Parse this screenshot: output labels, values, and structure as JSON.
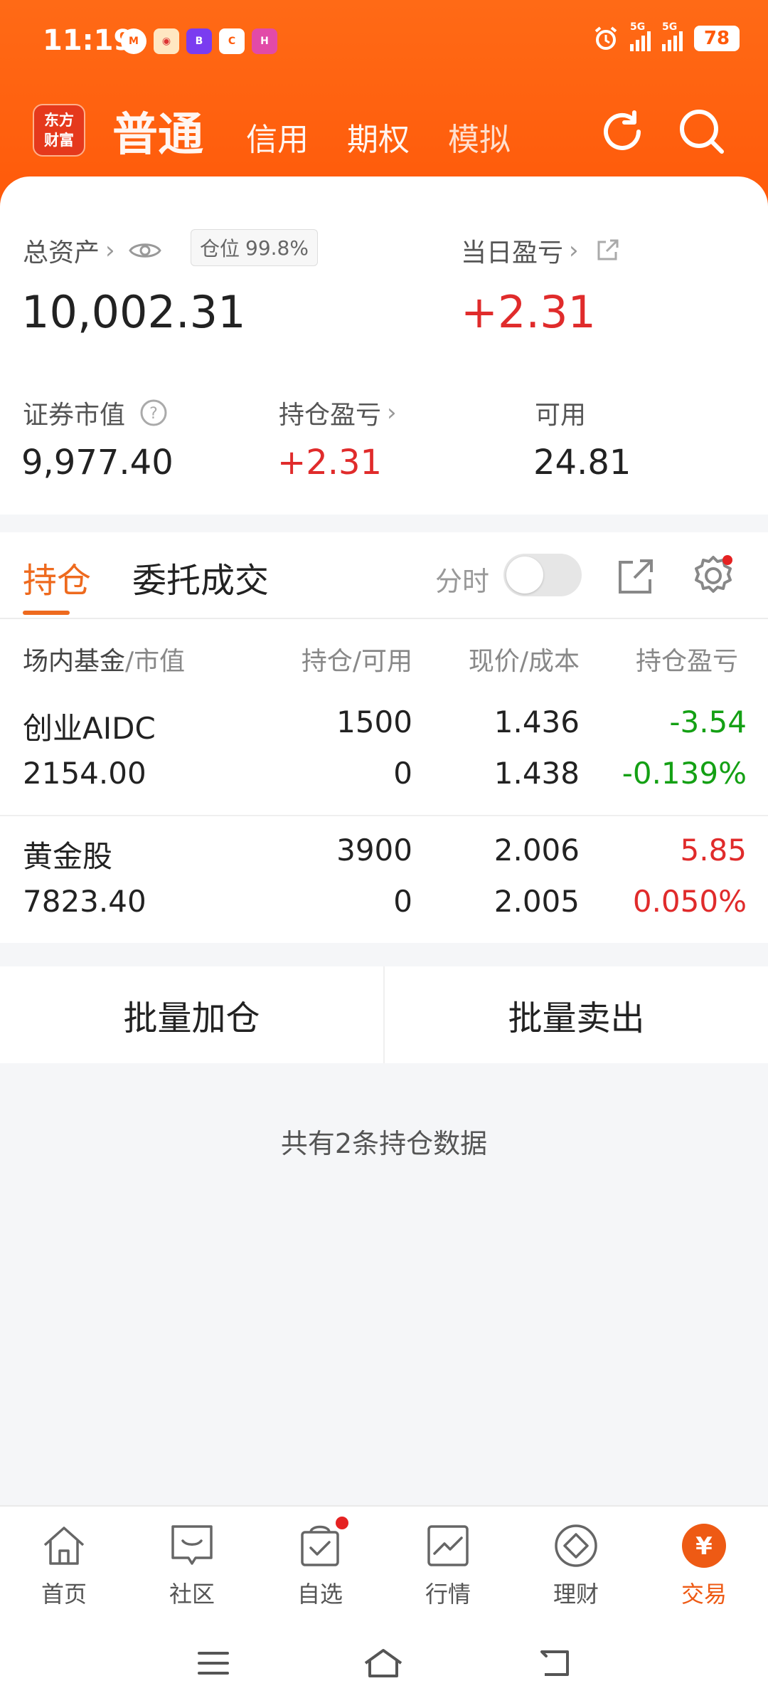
{
  "status": {
    "time": "11:19",
    "net1": "5G",
    "net2": "5G",
    "battery": "78"
  },
  "header": {
    "logo": [
      "东方",
      "财富"
    ],
    "tabs": [
      {
        "label": "普通",
        "active": true
      },
      {
        "label": "信用",
        "active": false
      },
      {
        "label": "期权",
        "active": false
      },
      {
        "label": "模拟",
        "active": false
      }
    ],
    "icons": [
      "refresh-icon",
      "search-icon"
    ]
  },
  "summary": {
    "total_assets_label": "总资产",
    "position_label": "仓位",
    "position_value": "99.8%",
    "total_assets_value": "10,002.31",
    "daily_pl_label": "当日盈亏",
    "daily_pl_value": "+2.31",
    "market_value_label": "证券市值",
    "market_value_value": "9,977.40",
    "holding_pl_label": "持仓盈亏",
    "holding_pl_value": "+2.31",
    "available_label": "可用",
    "available_value": "24.81"
  },
  "position_tabs": {
    "holdings": "持仓",
    "orders": "委托成交",
    "timeshare": "分时"
  },
  "table": {
    "headers": {
      "col1_main": "场内基金",
      "col1_sub": "/市值",
      "col2": "持仓/可用",
      "col3": "现价/成本",
      "col4": "持仓盈亏"
    },
    "rows": [
      {
        "name": "创业AIDC",
        "market_value": "2154.00",
        "holding": "1500",
        "available": "0",
        "price": "1.436",
        "cost": "1.438",
        "pl": "-3.54",
        "pl_pct": "-0.139%",
        "dir": "down"
      },
      {
        "name": "黄金股",
        "market_value": "7823.40",
        "holding": "3900",
        "available": "0",
        "price": "2.006",
        "cost": "2.005",
        "pl": "5.85",
        "pl_pct": "0.050%",
        "dir": "up"
      }
    ]
  },
  "batch": {
    "add": "批量加仓",
    "sell": "批量卖出"
  },
  "count_text": "共有2条持仓数据",
  "nav": [
    {
      "label": "首页",
      "icon": "home-icon"
    },
    {
      "label": "社区",
      "icon": "community-icon"
    },
    {
      "label": "自选",
      "icon": "watchlist-icon"
    },
    {
      "label": "行情",
      "icon": "market-icon"
    },
    {
      "label": "理财",
      "icon": "wealth-icon"
    },
    {
      "label": "交易",
      "icon": "trade-icon"
    }
  ],
  "colors": {
    "brand": "#ff5a0a",
    "up": "#e02b2b",
    "down": "#14a014",
    "accent": "#ee6a1e"
  }
}
